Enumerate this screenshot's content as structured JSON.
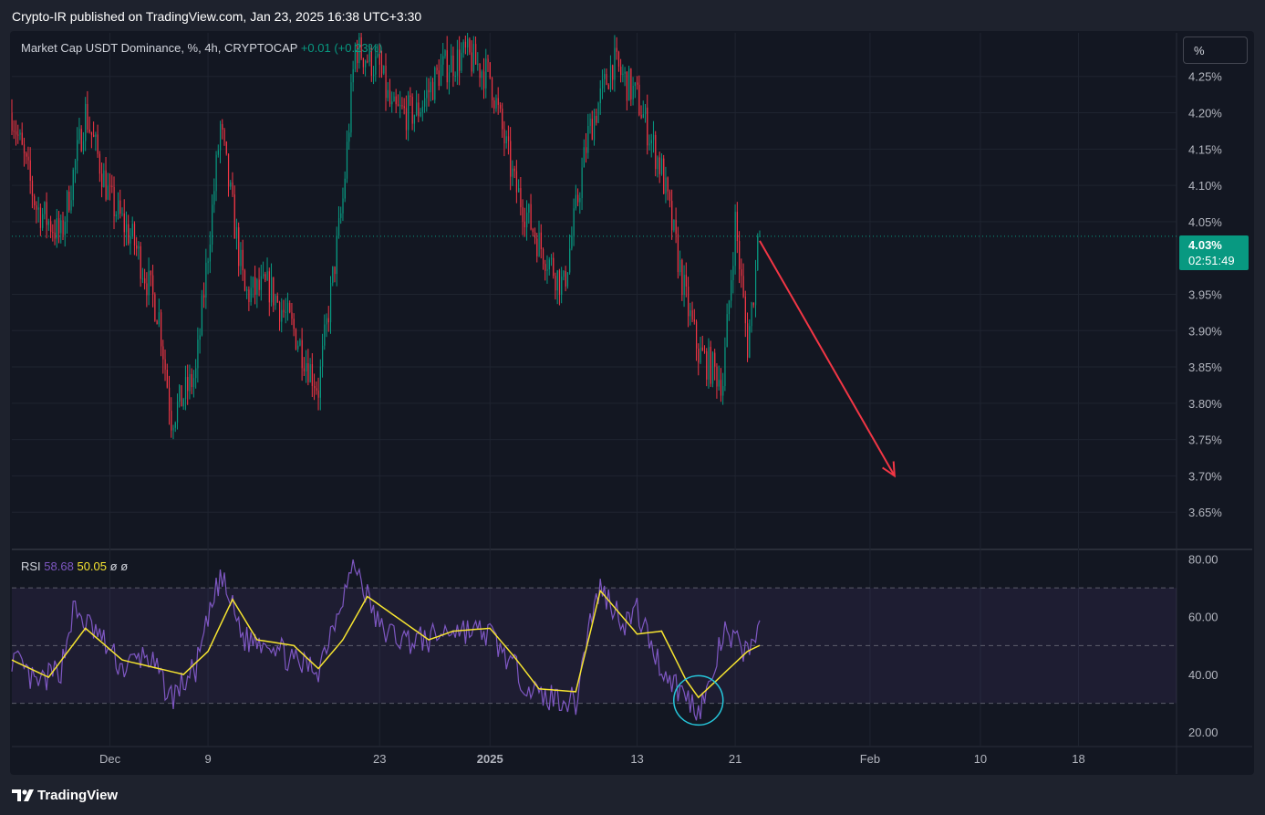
{
  "publisher_line": "Crypto-IR published on TradingView.com, Jan 23, 2025 16:38 UTC+3:30",
  "legend": {
    "symbol": "Market Cap USDT Dominance, %, 4h, CRYPTOCAP",
    "change": "+0.01 (+0.23%)"
  },
  "scale_button": "%",
  "price_tag": {
    "value": "4.03%",
    "countdown": "02:51:49"
  },
  "rsi_legend": {
    "name": "RSI",
    "rsi_value": "58.68",
    "ma_value": "50.05",
    "extra1": "ø",
    "extra2": "ø"
  },
  "footer": {
    "brand": "TradingView"
  },
  "colors": {
    "up": "#089981",
    "down": "#f23645",
    "rsi_line": "#7e57c2",
    "rsi_ma": "#f7e530",
    "arrow": "#f23645",
    "circle": "#26c6da",
    "background": "#131722"
  },
  "chart_data": [
    {
      "type": "candlestick",
      "title": "Market Cap USDT Dominance, %, 4h, CRYPTOCAP",
      "timeframe": "4h",
      "y_unit": "%",
      "price_ticks": [
        "4.25%",
        "4.20%",
        "4.15%",
        "4.10%",
        "4.05%",
        "3.95%",
        "3.90%",
        "3.85%",
        "3.80%",
        "3.75%",
        "3.70%",
        "3.65%"
      ],
      "ylim": [
        3.6,
        4.31
      ],
      "x_ticks": [
        {
          "label": "Dec",
          "date": "2024-12-01"
        },
        {
          "label": "9",
          "date": "2024-12-09"
        },
        {
          "label": "23",
          "date": "2024-12-23"
        },
        {
          "label": "2025",
          "date": "2025-01-01"
        },
        {
          "label": "13",
          "date": "2025-01-13"
        },
        {
          "label": "21",
          "date": "2025-01-21"
        },
        {
          "label": "Feb",
          "date": "2025-02-01"
        },
        {
          "label": "10",
          "date": "2025-02-10"
        },
        {
          "label": "18",
          "date": "2025-02-18"
        }
      ],
      "xlim": [
        "2024-11-23",
        "2025-02-26"
      ],
      "x_end": "2025-01-23",
      "current_price": 4.03,
      "approx_path": [
        {
          "date": "2024-11-23",
          "value": 4.2
        },
        {
          "date": "2024-11-25",
          "value": 4.07
        },
        {
          "date": "2024-11-27",
          "value": 4.03
        },
        {
          "date": "2024-11-29",
          "value": 4.2
        },
        {
          "date": "2024-12-01",
          "value": 4.08
        },
        {
          "date": "2024-12-03",
          "value": 4.02
        },
        {
          "date": "2024-12-05",
          "value": 3.92
        },
        {
          "date": "2024-12-06",
          "value": 3.78
        },
        {
          "date": "2024-12-08",
          "value": 3.84
        },
        {
          "date": "2024-12-10",
          "value": 4.18
        },
        {
          "date": "2024-12-12",
          "value": 3.95
        },
        {
          "date": "2024-12-14",
          "value": 3.96
        },
        {
          "date": "2024-12-16",
          "value": 3.9
        },
        {
          "date": "2024-12-18",
          "value": 3.82
        },
        {
          "date": "2024-12-20",
          "value": 4.08
        },
        {
          "date": "2024-12-21",
          "value": 4.29
        },
        {
          "date": "2024-12-23",
          "value": 4.26
        },
        {
          "date": "2024-12-24",
          "value": 4.2
        },
        {
          "date": "2024-12-26",
          "value": 4.2
        },
        {
          "date": "2024-12-28",
          "value": 4.26
        },
        {
          "date": "2024-12-30",
          "value": 4.28
        },
        {
          "date": "2025-01-01",
          "value": 4.25
        },
        {
          "date": "2025-01-03",
          "value": 4.1
        },
        {
          "date": "2025-01-05",
          "value": 4.02
        },
        {
          "date": "2025-01-07",
          "value": 3.96
        },
        {
          "date": "2025-01-09",
          "value": 4.17
        },
        {
          "date": "2025-01-11",
          "value": 4.27
        },
        {
          "date": "2025-01-13",
          "value": 4.22
        },
        {
          "date": "2025-01-15",
          "value": 4.12
        },
        {
          "date": "2025-01-17",
          "value": 3.94
        },
        {
          "date": "2025-01-18",
          "value": 3.87
        },
        {
          "date": "2025-01-20",
          "value": 3.83
        },
        {
          "date": "2025-01-21",
          "value": 4.05
        },
        {
          "date": "2025-01-22",
          "value": 3.88
        },
        {
          "date": "2025-01-23",
          "value": 4.03
        }
      ],
      "annotations": [
        {
          "type": "arrow",
          "from": {
            "date": "2025-01-23",
            "value": 4.03
          },
          "to": {
            "date": "2025-02-03",
            "value": 3.7
          },
          "color": "#f23645"
        }
      ],
      "grid": true
    },
    {
      "type": "line",
      "title": "RSI",
      "y_ticks": [
        "80.00",
        "60.00",
        "40.00",
        "20.00"
      ],
      "ylim": [
        15,
        83
      ],
      "band": [
        30,
        70
      ],
      "midline": 50,
      "series": [
        {
          "name": "RSI",
          "color": "#7e57c2",
          "values": [
            {
              "date": "2024-11-23",
              "value": 46
            },
            {
              "date": "2024-11-25",
              "value": 36
            },
            {
              "date": "2024-11-27",
              "value": 42
            },
            {
              "date": "2024-11-28",
              "value": 62
            },
            {
              "date": "2024-11-30",
              "value": 54
            },
            {
              "date": "2024-12-02",
              "value": 42
            },
            {
              "date": "2024-12-04",
              "value": 47
            },
            {
              "date": "2024-12-06",
              "value": 32
            },
            {
              "date": "2024-12-08",
              "value": 42
            },
            {
              "date": "2024-12-10",
              "value": 74
            },
            {
              "date": "2024-12-12",
              "value": 52
            },
            {
              "date": "2024-12-14",
              "value": 52
            },
            {
              "date": "2024-12-16",
              "value": 44
            },
            {
              "date": "2024-12-18",
              "value": 42
            },
            {
              "date": "2024-12-20",
              "value": 68
            },
            {
              "date": "2024-12-21",
              "value": 78
            },
            {
              "date": "2024-12-23",
              "value": 56
            },
            {
              "date": "2024-12-25",
              "value": 52
            },
            {
              "date": "2024-12-27",
              "value": 52
            },
            {
              "date": "2024-12-29",
              "value": 56
            },
            {
              "date": "2025-01-01",
              "value": 54
            },
            {
              "date": "2025-01-03",
              "value": 42
            },
            {
              "date": "2025-01-05",
              "value": 32
            },
            {
              "date": "2025-01-07",
              "value": 32
            },
            {
              "date": "2025-01-08",
              "value": 30
            },
            {
              "date": "2025-01-09",
              "value": 56
            },
            {
              "date": "2025-01-10",
              "value": 70
            },
            {
              "date": "2025-01-12",
              "value": 58
            },
            {
              "date": "2025-01-13",
              "value": 62
            },
            {
              "date": "2025-01-15",
              "value": 42
            },
            {
              "date": "2025-01-17",
              "value": 32
            },
            {
              "date": "2025-01-18",
              "value": 28
            },
            {
              "date": "2025-01-19",
              "value": 36
            },
            {
              "date": "2025-01-20",
              "value": 54
            },
            {
              "date": "2025-01-22",
              "value": 48
            },
            {
              "date": "2025-01-23",
              "value": 58.68
            }
          ]
        },
        {
          "name": "MA",
          "color": "#f7e530",
          "values": [
            {
              "date": "2024-11-23",
              "value": 45
            },
            {
              "date": "2024-11-26",
              "value": 39
            },
            {
              "date": "2024-11-29",
              "value": 56
            },
            {
              "date": "2024-12-02",
              "value": 45
            },
            {
              "date": "2024-12-04",
              "value": 43
            },
            {
              "date": "2024-12-07",
              "value": 40
            },
            {
              "date": "2024-12-09",
              "value": 48
            },
            {
              "date": "2024-12-11",
              "value": 66
            },
            {
              "date": "2024-12-13",
              "value": 52
            },
            {
              "date": "2024-12-16",
              "value": 50
            },
            {
              "date": "2024-12-18",
              "value": 42
            },
            {
              "date": "2024-12-20",
              "value": 52
            },
            {
              "date": "2024-12-22",
              "value": 67
            },
            {
              "date": "2024-12-25",
              "value": 58
            },
            {
              "date": "2024-12-27",
              "value": 52
            },
            {
              "date": "2024-12-29",
              "value": 55
            },
            {
              "date": "2025-01-01",
              "value": 56
            },
            {
              "date": "2025-01-03",
              "value": 46
            },
            {
              "date": "2025-01-05",
              "value": 35
            },
            {
              "date": "2025-01-08",
              "value": 34
            },
            {
              "date": "2025-01-10",
              "value": 69
            },
            {
              "date": "2025-01-13",
              "value": 54
            },
            {
              "date": "2025-01-15",
              "value": 55
            },
            {
              "date": "2025-01-17",
              "value": 38
            },
            {
              "date": "2025-01-18",
              "value": 32
            },
            {
              "date": "2025-01-20",
              "value": 40
            },
            {
              "date": "2025-01-22",
              "value": 48
            },
            {
              "date": "2025-01-23",
              "value": 50.05
            }
          ]
        }
      ],
      "annotations": [
        {
          "type": "circle",
          "center": {
            "date": "2025-01-18",
            "value": 31
          },
          "color": "#26c6da"
        }
      ]
    }
  ]
}
